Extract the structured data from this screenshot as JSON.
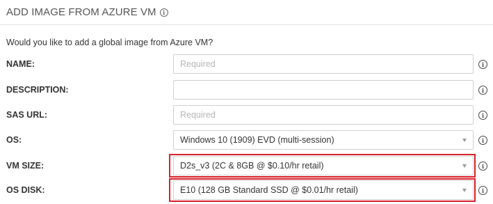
{
  "header": {
    "title": "ADD IMAGE FROM AZURE VM",
    "info_icon": "info-icon"
  },
  "question": "Would you like to add a global image from Azure VM?",
  "form": {
    "name": {
      "label": "NAME:",
      "value": "",
      "placeholder": "Required"
    },
    "description": {
      "label": "DESCRIPTION:",
      "value": "",
      "placeholder": ""
    },
    "sas_url": {
      "label": "SAS URL:",
      "value": "",
      "placeholder": "Required"
    },
    "os": {
      "label": "OS:",
      "selected": "Windows 10 (1909) EVD (multi-session)"
    },
    "vm_size": {
      "label": "VM SIZE:",
      "selected": "D2s_v3 (2C & 8GB @ $0.10/hr retail)"
    },
    "os_disk": {
      "label": "OS DISK:",
      "selected": "E10 (128 GB Standard SSD @ $0.01/hr retail)"
    }
  },
  "colors": {
    "highlight": "#d8202a",
    "border": "#cfcfcf",
    "placeholder": "#b5b5b5"
  }
}
